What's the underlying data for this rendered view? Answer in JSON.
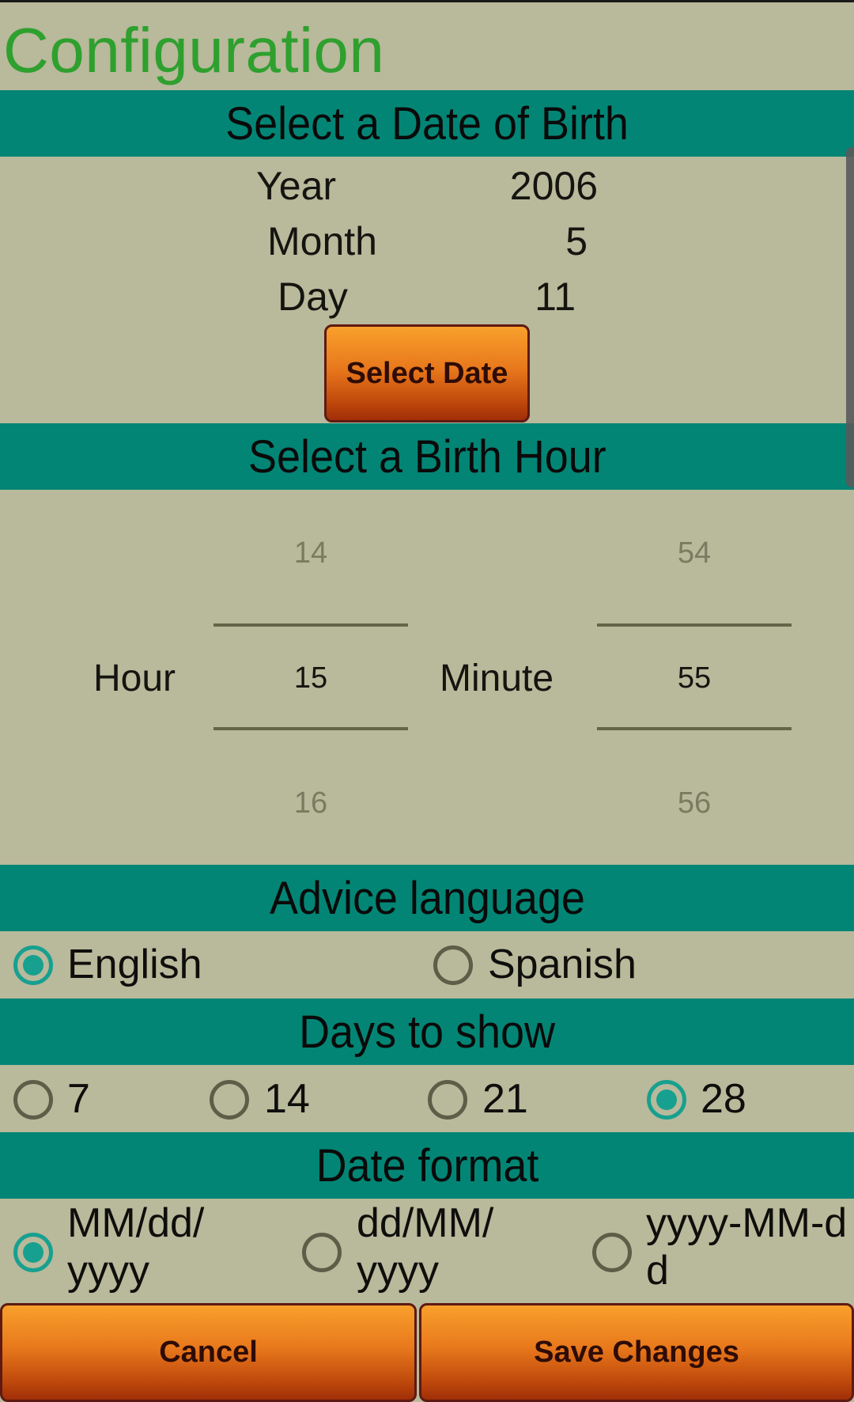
{
  "page": {
    "title": "Configuration"
  },
  "colors": {
    "background": "#b9b99b",
    "band": "#038575",
    "title": "#2ea02e",
    "radio_checked": "#17a08f",
    "radio_unchecked": "#5d5d48",
    "button_top": "#f8a02c",
    "button_bottom": "#a02e08"
  },
  "dob": {
    "header": "Select a Date of Birth",
    "year_label": "Year",
    "year_value": "2006",
    "month_label": "Month",
    "month_value": "5",
    "day_label": "Day",
    "day_value": "11",
    "select_button": "Select Date"
  },
  "birth_hour": {
    "header": "Select a Birth Hour",
    "hour_label": "Hour",
    "hour_prev": "14",
    "hour_value": "15",
    "hour_next": "16",
    "minute_label": "Minute",
    "minute_prev": "54",
    "minute_value": "55",
    "minute_next": "56"
  },
  "advice_language": {
    "header": "Advice language",
    "options": [
      {
        "label": "English",
        "checked": true
      },
      {
        "label": "Spanish",
        "checked": false
      }
    ]
  },
  "days_to_show": {
    "header": "Days to show",
    "options": [
      {
        "label": "7",
        "checked": false
      },
      {
        "label": "14",
        "checked": false
      },
      {
        "label": "21",
        "checked": false
      },
      {
        "label": "28",
        "checked": true
      }
    ]
  },
  "date_format": {
    "header": "Date format",
    "options": [
      {
        "line1": "MM/dd/",
        "line2": "yyyy",
        "checked": true
      },
      {
        "line1": "dd/MM/",
        "line2": "yyyy",
        "checked": false
      },
      {
        "line1": "yyyy-MM-d",
        "line2": "d",
        "checked": false
      }
    ]
  },
  "actions": {
    "cancel": "Cancel",
    "save": "Save Changes"
  }
}
